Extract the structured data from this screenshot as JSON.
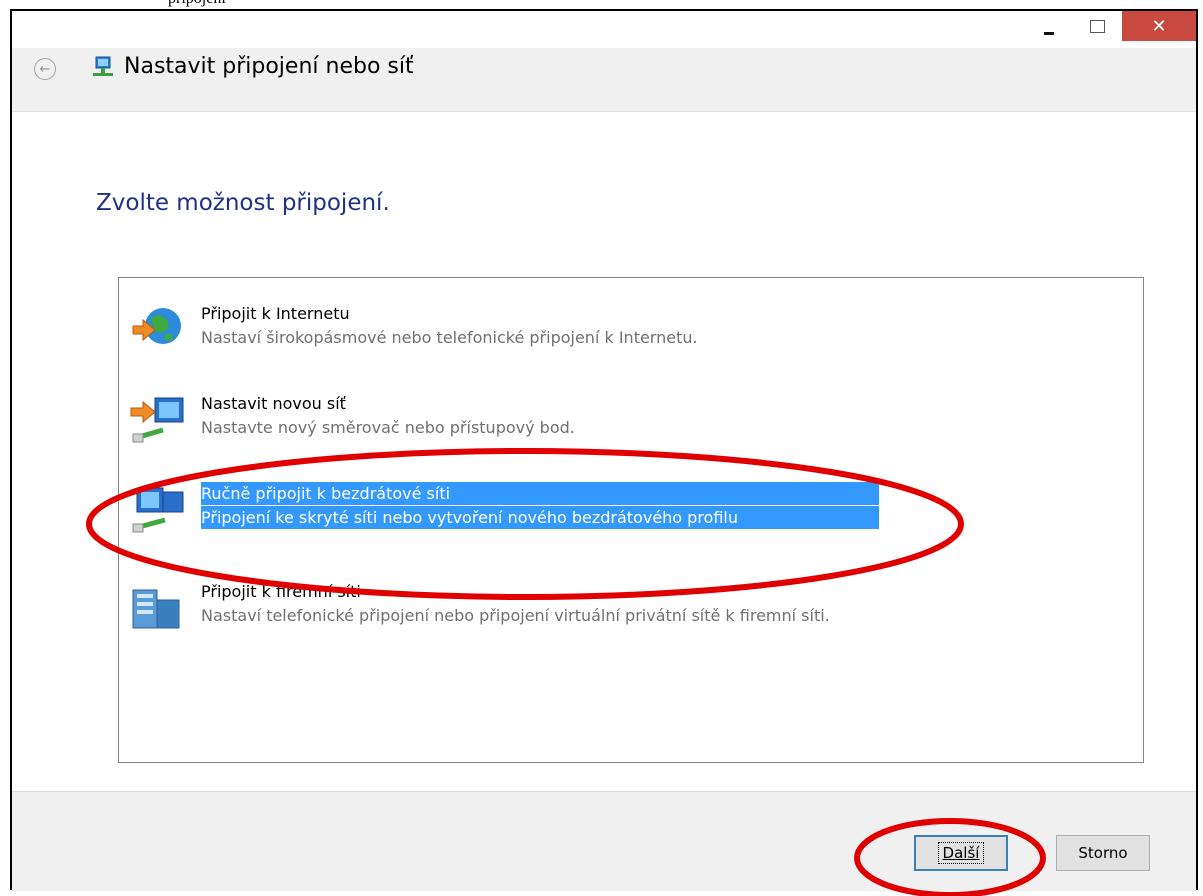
{
  "doc_fragment": "připojení",
  "window": {
    "back_arrow": "←",
    "close_glyph": "✕",
    "title": "Nastavit připojení nebo síť"
  },
  "heading": "Zvolte možnost připojení.",
  "options": [
    {
      "title": "Připojit k Internetu",
      "description": "Nastaví širokopásmové nebo telefonické připojení k Internetu.",
      "icon": "globe-connect-icon"
    },
    {
      "title": "Nastavit novou síť",
      "description": "Nastavte nový směrovač nebo přístupový bod.",
      "icon": "new-network-icon"
    },
    {
      "title": "Ručně připojit k bezdrátové síti",
      "description": "Připojení ke skryté síti nebo vytvoření nového bezdrátového profilu",
      "icon": "wireless-network-icon",
      "selected": true
    },
    {
      "title": "Připojit k firemní síti",
      "description": "Nastaví telefonické připojení nebo připojení virtuální privátní sítě k firemní síti.",
      "icon": "workplace-network-icon"
    }
  ],
  "buttons": {
    "next": "Další",
    "cancel": "Storno"
  },
  "colors": {
    "selection": "#3399ff",
    "heading": "#1e3287",
    "annotation": "#e00000",
    "close_button": "#c7493f"
  }
}
